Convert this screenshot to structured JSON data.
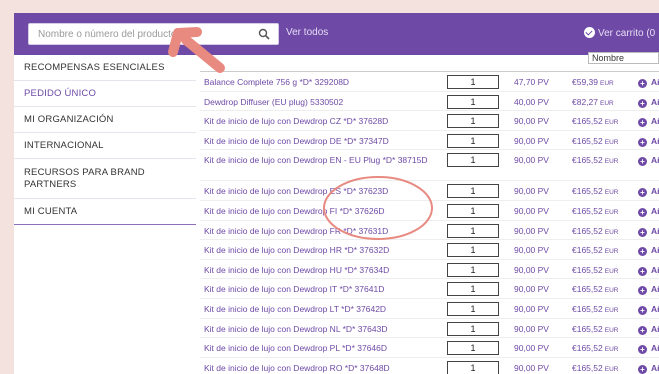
{
  "header": {
    "search_placeholder": "Nombre o número del producto",
    "ver_todos": "Ver todos",
    "ver_carrito": "Ver carrito (0",
    "sort_value": "Nombre"
  },
  "sidebar": {
    "items": [
      {
        "label": "RECOMPENSAS ESENCIALES"
      },
      {
        "label": "PEDIDO ÚNICO"
      },
      {
        "label": "MI ORGANIZACIÓN"
      },
      {
        "label": "INTERNACIONAL"
      },
      {
        "label": "RECURSOS PARA BRAND PARTNERS"
      },
      {
        "label": "MI CUENTA"
      }
    ]
  },
  "products": [
    {
      "name": "Balance Complete 756 g *D* 329208D",
      "qty": "1",
      "pv": "47,70 PV",
      "price": "€59,39",
      "currency": "EUR",
      "add": "Añ"
    },
    {
      "name": "Dewdrop Diffuser (EU plug) 5330502",
      "qty": "1",
      "pv": "40,00 PV",
      "price": "€82,27",
      "currency": "EUR",
      "add": "Añ"
    },
    {
      "name": "Kit de inicio de lujo con Dewdrop CZ *D* 37628D",
      "qty": "1",
      "pv": "90,00 PV",
      "price": "€165,52",
      "currency": "EUR",
      "add": "Añ"
    },
    {
      "name": "Kit de inicio de lujo con Dewdrop DE *D* 37347D",
      "qty": "1",
      "pv": "90,00 PV",
      "price": "€165,52",
      "currency": "EUR",
      "add": "Añ"
    },
    {
      "name": "Kit de inicio de lujo con Dewdrop EN - EU Plug *D* 38715D",
      "qty": "1",
      "pv": "90,00 PV",
      "price": "€165,52",
      "currency": "EUR",
      "add": "Añ"
    },
    {
      "name": "Kit de inicio de lujo con Dewdrop ES *D* 37623D",
      "qty": "1",
      "pv": "90,00 PV",
      "price": "€165,52",
      "currency": "EUR",
      "add": "Añ"
    },
    {
      "name": "Kit de inicio de lujo con Dewdrop FI *D* 37626D",
      "qty": "1",
      "pv": "90,00 PV",
      "price": "€165,52",
      "currency": "EUR",
      "add": "Añ"
    },
    {
      "name": "Kit de inicio de lujo con Dewdrop FR *D* 37631D",
      "qty": "1",
      "pv": "90,00 PV",
      "price": "€165,52",
      "currency": "EUR",
      "add": "Añ"
    },
    {
      "name": "Kit de inicio de lujo con Dewdrop HR *D* 37632D",
      "qty": "1",
      "pv": "90,00 PV",
      "price": "€165,52",
      "currency": "EUR",
      "add": "Añ"
    },
    {
      "name": "Kit de inicio de lujo con Dewdrop HU *D* 37634D",
      "qty": "1",
      "pv": "90,00 PV",
      "price": "€165,52",
      "currency": "EUR",
      "add": "Añ"
    },
    {
      "name": "Kit de inicio de lujo con Dewdrop IT *D* 37641D",
      "qty": "1",
      "pv": "90,00 PV",
      "price": "€165,52",
      "currency": "EUR",
      "add": "Añ"
    },
    {
      "name": "Kit de inicio de lujo con Dewdrop LT *D* 37642D",
      "qty": "1",
      "pv": "90,00 PV",
      "price": "€165,52",
      "currency": "EUR",
      "add": "Añ"
    },
    {
      "name": "Kit de inicio de lujo con Dewdrop NL *D* 37643D",
      "qty": "1",
      "pv": "90,00 PV",
      "price": "€165,52",
      "currency": "EUR",
      "add": "Añ"
    },
    {
      "name": "Kit de inicio de lujo con Dewdrop PL *D* 37646D",
      "qty": "1",
      "pv": "90,00 PV",
      "price": "€165,52",
      "currency": "EUR",
      "add": "Añ"
    },
    {
      "name": "Kit de inicio de lujo con Dewdrop RO *D* 37648D",
      "qty": "1",
      "pv": "90,00 PV",
      "price": "€165,52",
      "currency": "EUR",
      "add": "Añ"
    }
  ],
  "colors": {
    "brand_purple": "#6e4aa6",
    "page_background": "#f4e2df",
    "annotation_coral": "#e88a80"
  },
  "icons": [
    "search-icon",
    "check-circle-icon",
    "plus-circle-icon",
    "arrow-annotation-icon"
  ]
}
